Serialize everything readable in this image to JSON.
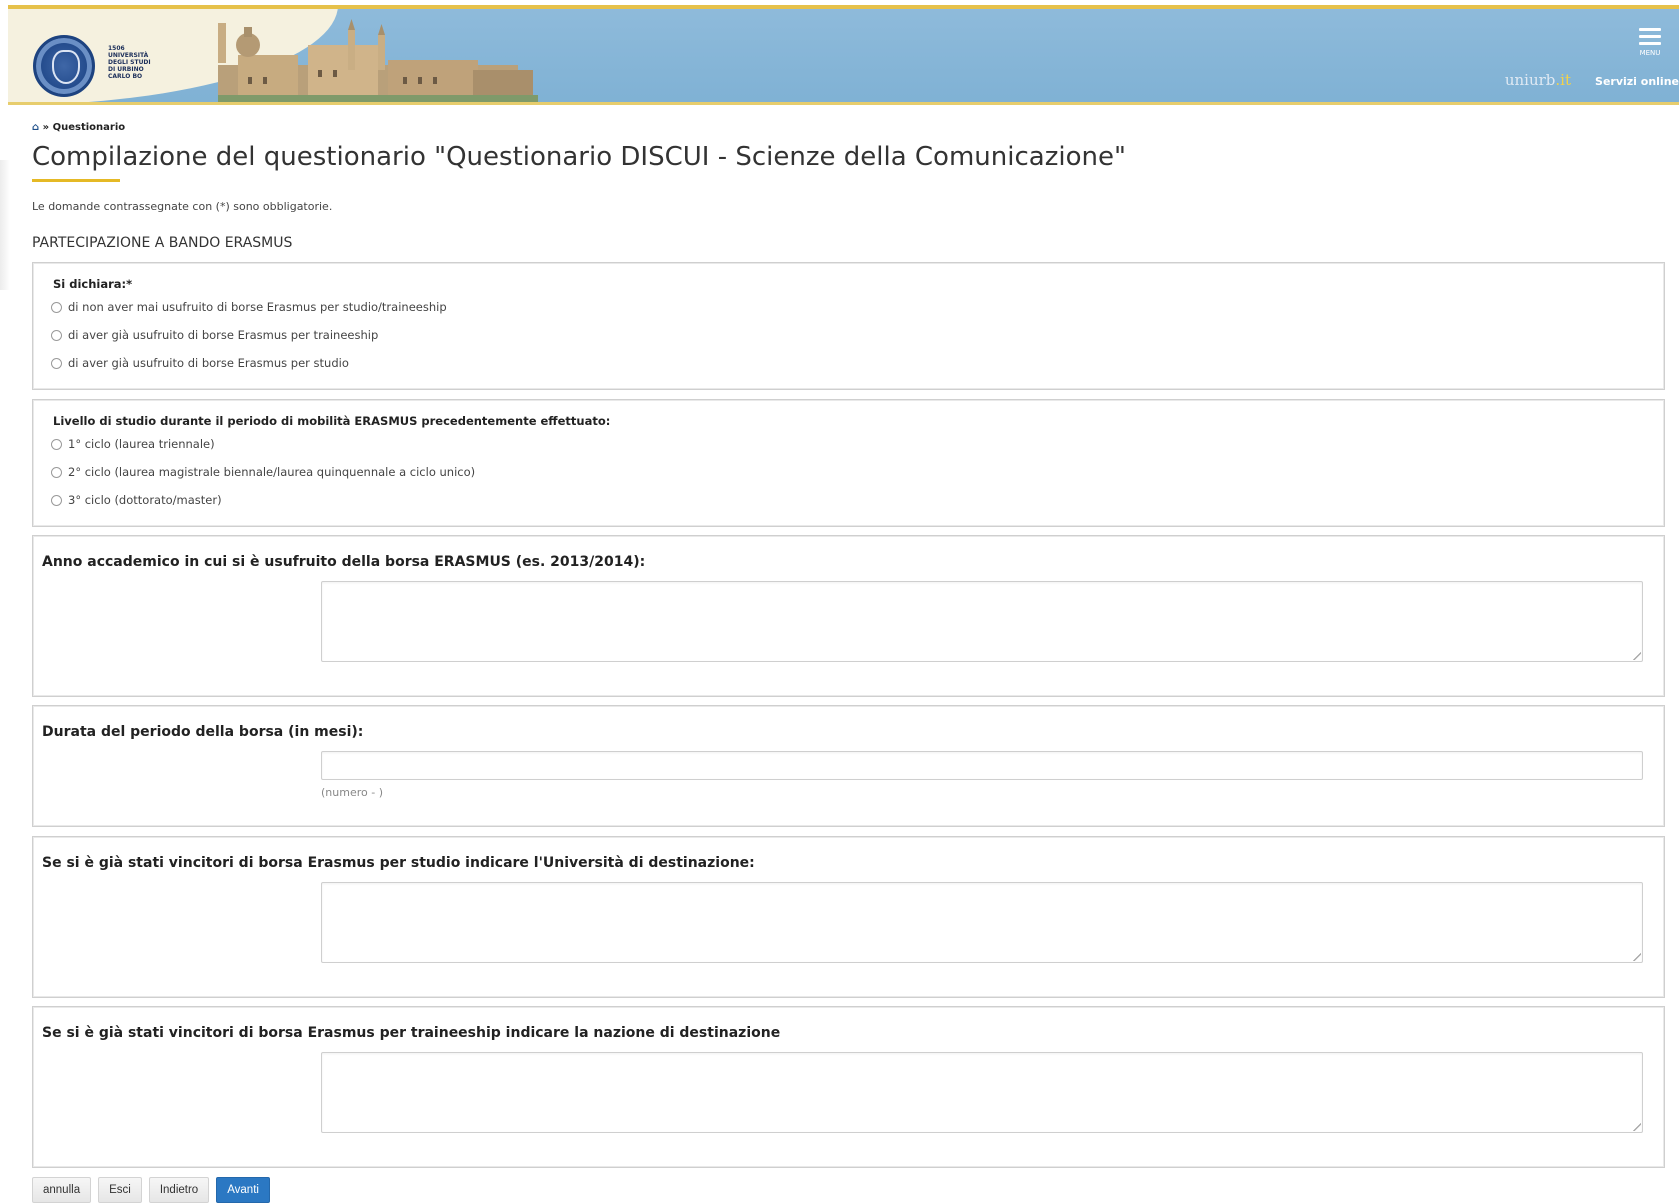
{
  "header": {
    "logo_lines": [
      "1506",
      "UNIVERSITÀ",
      "DEGLI STUDI",
      "DI URBINO",
      "CARLO BO"
    ],
    "menu_label": "MENU",
    "brand": "uniurb",
    "brand_suffix": ".it",
    "servizi": "Servizi online",
    "colors": {
      "sky": "#8bb8d8",
      "gold": "#e8c22f",
      "seal": "#234b8c"
    }
  },
  "breadcrumb": {
    "current": "Questionario"
  },
  "page": {
    "title": "Compilazione del questionario \"Questionario DISCUI - Scienze della Comunicazione\"",
    "note": "Le domande contrassegnate con (*) sono obbligatorie.",
    "section": "PARTECIPAZIONE A BANDO ERASMUS"
  },
  "questions": {
    "q1": {
      "label": "Si dichiara:*",
      "options": [
        "di non aver mai usufruito di borse Erasmus per studio/traineeship",
        "di aver già usufruito di borse Erasmus per traineeship",
        "di aver già usufruito di borse Erasmus per studio"
      ]
    },
    "q2": {
      "label": "Livello di studio durante il periodo di mobilità ERASMUS precedentemente effettuato:",
      "options": [
        "1° ciclo (laurea triennale)",
        "2° ciclo (laurea magistrale biennale/laurea quinquennale a ciclo unico)",
        "3° ciclo (dottorato/master)"
      ]
    },
    "q3": {
      "label": "Anno accademico in cui si è usufruito della borsa ERASMUS (es. 2013/2014):",
      "value": ""
    },
    "q4": {
      "label": "Durata del periodo della borsa (in mesi):",
      "value": "",
      "hint": "(numero - )"
    },
    "q5": {
      "label": "Se si è già stati vincitori di borsa Erasmus per studio indicare l'Università di destinazione:",
      "value": ""
    },
    "q6": {
      "label": "Se si è già stati vincitori di borsa Erasmus per traineeship indicare la nazione di destinazione",
      "value": ""
    }
  },
  "buttons": {
    "annulla": "annulla",
    "esci": "Esci",
    "indietro": "Indietro",
    "avanti": "Avanti"
  }
}
